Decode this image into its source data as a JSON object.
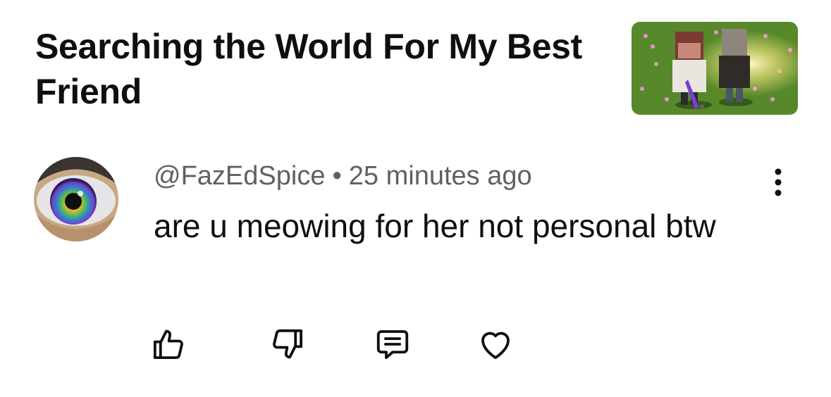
{
  "video": {
    "title": "Searching the World For My Best Friend"
  },
  "comment": {
    "author": "@FazEdSpice",
    "separator": "•",
    "time": "25 minutes ago",
    "text": "are u meowing for her not personal btw"
  },
  "icons": {
    "thumbnail": "video-thumbnail",
    "avatar": "eye-avatar",
    "more": "more-vertical-icon",
    "like": "thumb-up-icon",
    "dislike": "thumb-down-icon",
    "reply": "reply-icon",
    "heart": "heart-icon"
  },
  "colors": {
    "text": "#0f0f0f",
    "meta": "#606060",
    "background": "#ffffff"
  }
}
